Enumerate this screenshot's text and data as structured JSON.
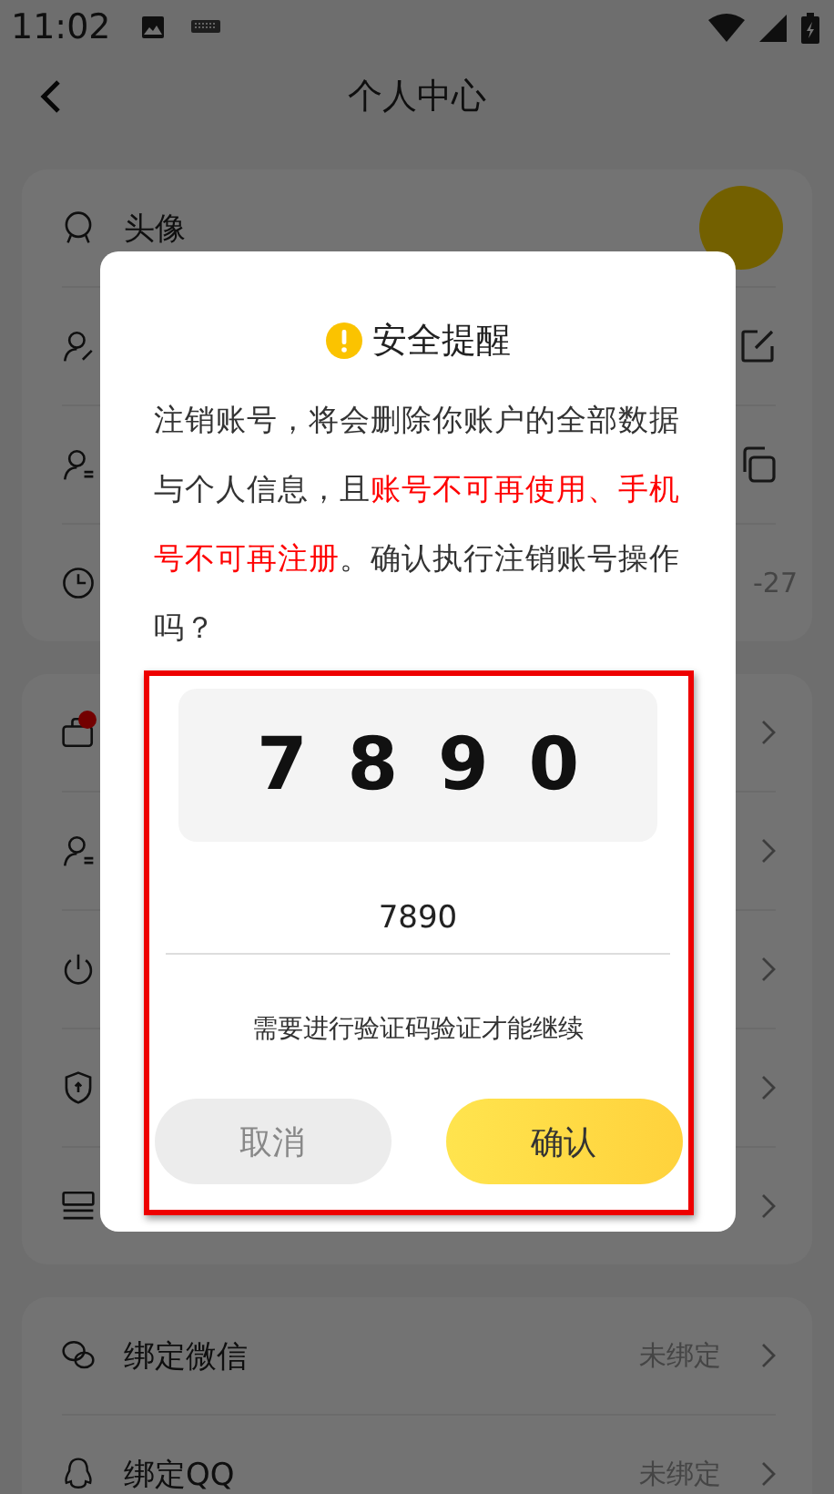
{
  "status_bar": {
    "time": "11:02"
  },
  "header": {
    "title": "个人中心"
  },
  "profile_card": {
    "rows": [
      {
        "kind": "avatar",
        "label": "头像"
      },
      {
        "kind": "edit"
      },
      {
        "kind": "copy"
      },
      {
        "kind": "value",
        "value": "-27"
      }
    ]
  },
  "settings_card": {
    "rows": [
      {
        "alert": true
      },
      {
        "alert": false
      },
      {
        "alert": false
      },
      {
        "alert": false
      },
      {
        "alert": false
      }
    ]
  },
  "binding_card": {
    "rows": [
      {
        "label": "绑定微信",
        "value": "未绑定"
      },
      {
        "label": "绑定QQ",
        "value": "未绑定"
      }
    ]
  },
  "dialog": {
    "title": "安全提醒",
    "message": [
      {
        "text": "注销账号，将会删除你账户的全部数据与个人信息，且",
        "emphasis": false
      },
      {
        "text": "账号不可再使用、手机号不可再注册",
        "emphasis": true
      },
      {
        "text": "。确认执行注销账号操作吗？",
        "emphasis": false
      }
    ],
    "captcha": "7 8 9 0",
    "input_value": "7890",
    "hint": "需要进行验证码验证才能继续",
    "buttons": [
      {
        "kind": "cancel",
        "label": "取消"
      },
      {
        "kind": "confirm",
        "label": "确认"
      }
    ]
  }
}
